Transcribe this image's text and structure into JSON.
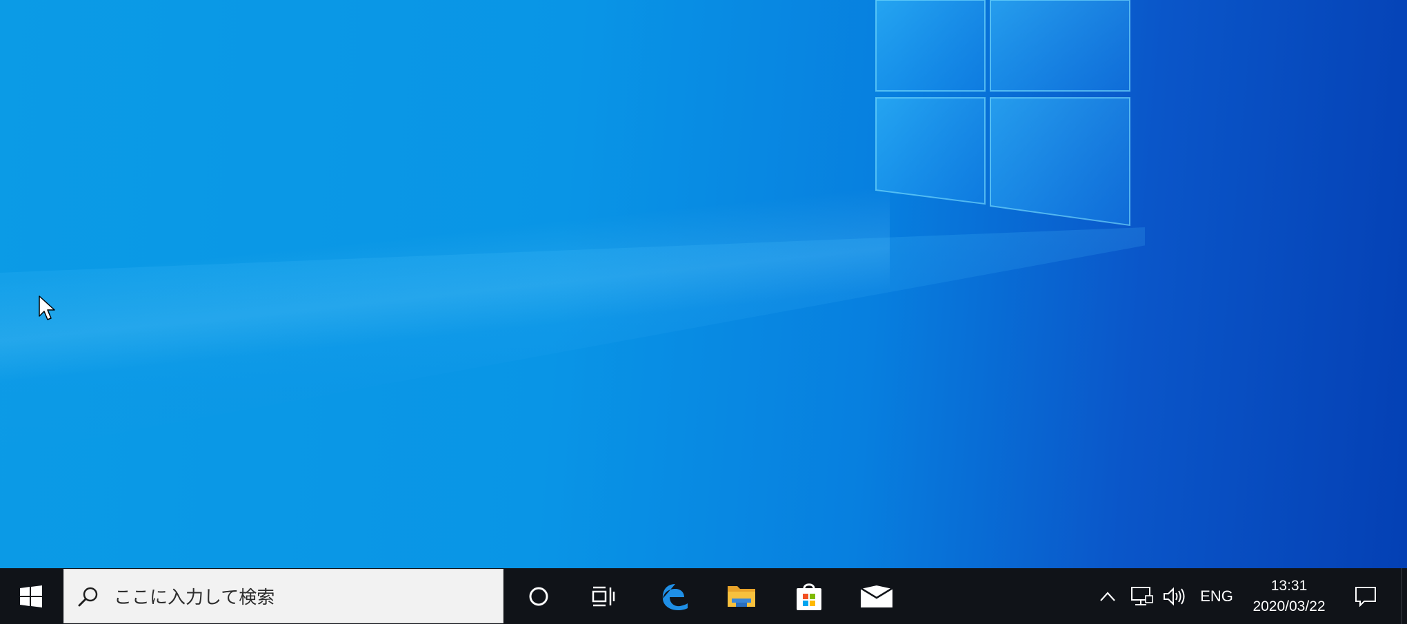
{
  "desktop": {
    "background_colors": [
      "#0b9be6",
      "#077fdf",
      "#0440b4"
    ],
    "logo_icon": "windows-logo-icon",
    "cursor_icon": "arrow-cursor-icon"
  },
  "taskbar": {
    "background": "#101318",
    "start_icon": "windows-start-icon",
    "search": {
      "icon": "search-icon",
      "placeholder": "ここに入力して検索"
    },
    "cortana_icon": "cortana-circle-icon",
    "task_view_icon": "task-view-icon",
    "pinned_apps": [
      {
        "name": "Microsoft Edge",
        "icon": "edge-icon"
      },
      {
        "name": "File Explorer",
        "icon": "folder-icon"
      },
      {
        "name": "Microsoft Store",
        "icon": "store-bag-icon"
      },
      {
        "name": "Mail",
        "icon": "mail-icon"
      }
    ],
    "tray": {
      "chevron_icon": "chevron-up-icon",
      "network_icon": "network-icon",
      "volume_icon": "volume-icon",
      "language": "ENG",
      "time": "13:31",
      "date": "2020/03/22",
      "notifications_icon": "action-center-icon"
    }
  }
}
